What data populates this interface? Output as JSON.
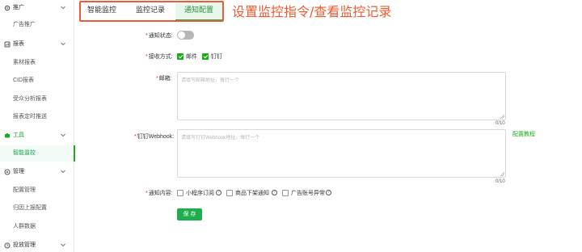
{
  "sidebar": {
    "groups": [
      {
        "label": "推广",
        "icon": "gear-icon"
      },
      {
        "label": "报表",
        "icon": "report-icon"
      },
      {
        "label": "工具",
        "icon": "tool-icon"
      },
      {
        "label": "管理",
        "icon": "settings-icon"
      },
      {
        "label": "投放管理",
        "icon": "launch-icon"
      }
    ],
    "items": [
      {
        "label": "广告推广"
      },
      {
        "label": "素材报表"
      },
      {
        "label": "CID报表"
      },
      {
        "label": "受众分析报表"
      },
      {
        "label": "报表定时推送"
      },
      {
        "label": "智能监控"
      },
      {
        "label": "配置管理"
      },
      {
        "label": "归因上报配置"
      },
      {
        "label": "人群数据"
      }
    ]
  },
  "tabs": [
    {
      "label": "智能监控"
    },
    {
      "label": "监控记录"
    },
    {
      "label": "通知配置"
    }
  ],
  "annotation": "设置监控指令/查看监控记录",
  "form": {
    "status_label": "通知状态:",
    "method_label": "接收方式:",
    "method_email": "邮件",
    "method_dingtalk": "钉钉",
    "email_label": "邮箱:",
    "email_placeholder": "请填写邮箱地址，每行一个",
    "email_count": "0/10",
    "webhook_label": "钉钉Webhook:",
    "webhook_placeholder": "请填写钉钉Webhook地址，每行一个",
    "webhook_count": "0/10",
    "config_link": "配置教程",
    "content_label": "通知内容:",
    "content_opt1": "小程序订阅",
    "content_opt2": "商品下架通知",
    "content_opt3": "广告账号异常",
    "save_label": "保 存",
    "accent_color": "#1aad19"
  }
}
